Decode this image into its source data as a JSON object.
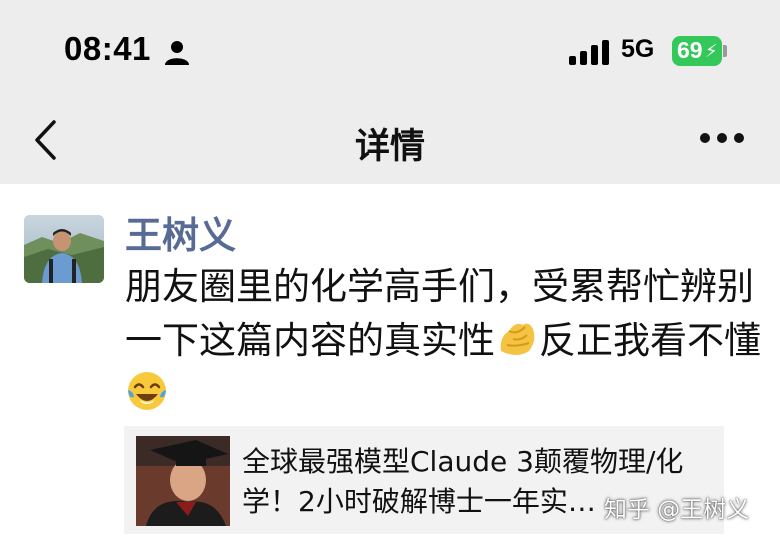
{
  "status_bar": {
    "time": "08:41",
    "network": "5G",
    "battery": "69"
  },
  "nav": {
    "title": "详情"
  },
  "post": {
    "username": "王树义",
    "text_part1": "朋友圈里的化学高手们，受累帮忙辨别一下这篇内容的真实性",
    "text_part2": "反正我看不懂",
    "emoji1": "pinching-hand-emoji",
    "emoji2": "tears-of-joy-emoji"
  },
  "link_card": {
    "title": "全球最强模型Claude 3颠覆物理/化学！2小时破解博士一年实…"
  },
  "watermark": "知乎 @王树义",
  "colors": {
    "username": "#576b95",
    "battery": "#34c759",
    "bar_bg": "#ededed",
    "card_bg": "#f2f2f2"
  }
}
